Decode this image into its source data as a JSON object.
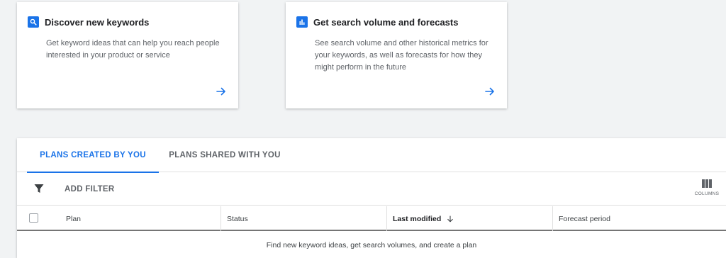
{
  "cards": [
    {
      "title": "Discover new keywords",
      "description": "Get keyword ideas that can help you reach people interested in your product or service",
      "icon": "search-icon"
    },
    {
      "title": "Get search volume and forecasts",
      "description": "See search volume and other historical metrics for your keywords, as well as forecasts for how they might perform in the future",
      "icon": "bar-chart-icon"
    }
  ],
  "tabs": [
    {
      "label": "PLANS CREATED BY YOU",
      "active": true
    },
    {
      "label": "PLANS SHARED WITH YOU",
      "active": false
    }
  ],
  "toolbar": {
    "add_filter_label": "ADD FILTER",
    "columns_label": "COLUMNS"
  },
  "table": {
    "columns": [
      "Plan",
      "Status",
      "Last modified",
      "Forecast period"
    ],
    "sorted_column": "Last modified",
    "sort_direction": "descending",
    "empty_message": "Find new keyword ideas, get search volumes, and create a plan"
  },
  "colors": {
    "accent": "#1a73e8",
    "text_secondary": "#5f6368",
    "background": "#f1f3f4"
  }
}
